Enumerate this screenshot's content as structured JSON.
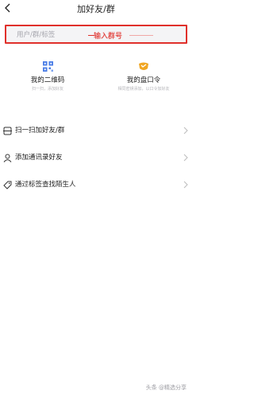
{
  "header": {
    "title": "加好友/群"
  },
  "search": {
    "placeholder": "用户/群/标签",
    "annotation": "输入群号"
  },
  "quick_cards": [
    {
      "label": "我的二维码",
      "sub": "扫一扫，添加好友",
      "icon": "qrcode-icon",
      "color": "#4a7de6"
    },
    {
      "label": "我的盘口令",
      "sub": "相同密钥添加，以口令加好友",
      "icon": "password-icon",
      "color": "#f0a623"
    }
  ],
  "list": [
    {
      "label": "扫一扫加好友/群",
      "icon": "scan-icon"
    },
    {
      "label": "添加通讯录好友",
      "icon": "contact-icon"
    },
    {
      "label": "通过标签查找陌生人",
      "icon": "tag-icon"
    }
  ],
  "watermark": "头条 @精选分享",
  "colors": {
    "annotation_red": "#e0302b",
    "search_bg": "#f4f4f6"
  }
}
